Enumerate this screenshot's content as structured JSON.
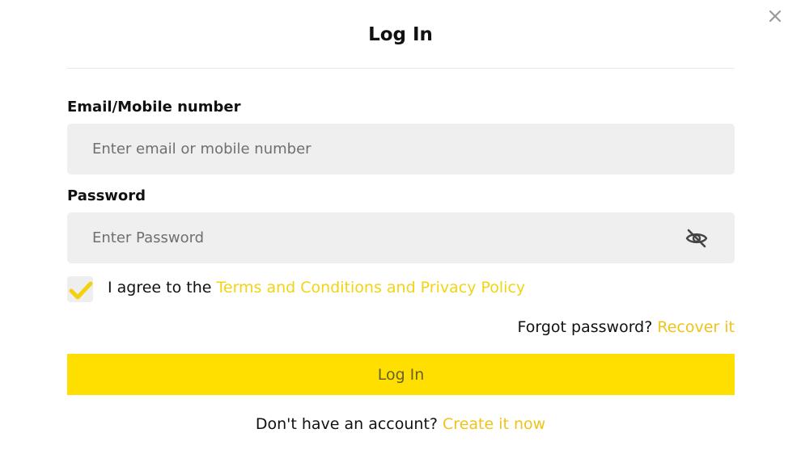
{
  "dialog": {
    "title": "Log In"
  },
  "email": {
    "label": "Email/Mobile number",
    "value": "",
    "placeholder": "Enter email or mobile number"
  },
  "password": {
    "label": "Password",
    "value": "",
    "placeholder": "Enter Password",
    "toggle_icon": "eye-off-icon"
  },
  "agreement": {
    "checked": true,
    "prefix": "I agree to the ",
    "link_text": "Terms and Conditions and Privacy Policy"
  },
  "forgot": {
    "prefix": "Forgot password? ",
    "link_text": "Recover it"
  },
  "login_button": {
    "label": "Log In"
  },
  "signup": {
    "prefix": "Don't have an account? ",
    "link_text": "Create it now"
  },
  "colors": {
    "accent": "#ffdf00",
    "link": "#f0c318",
    "input_bg": "#efefef"
  }
}
